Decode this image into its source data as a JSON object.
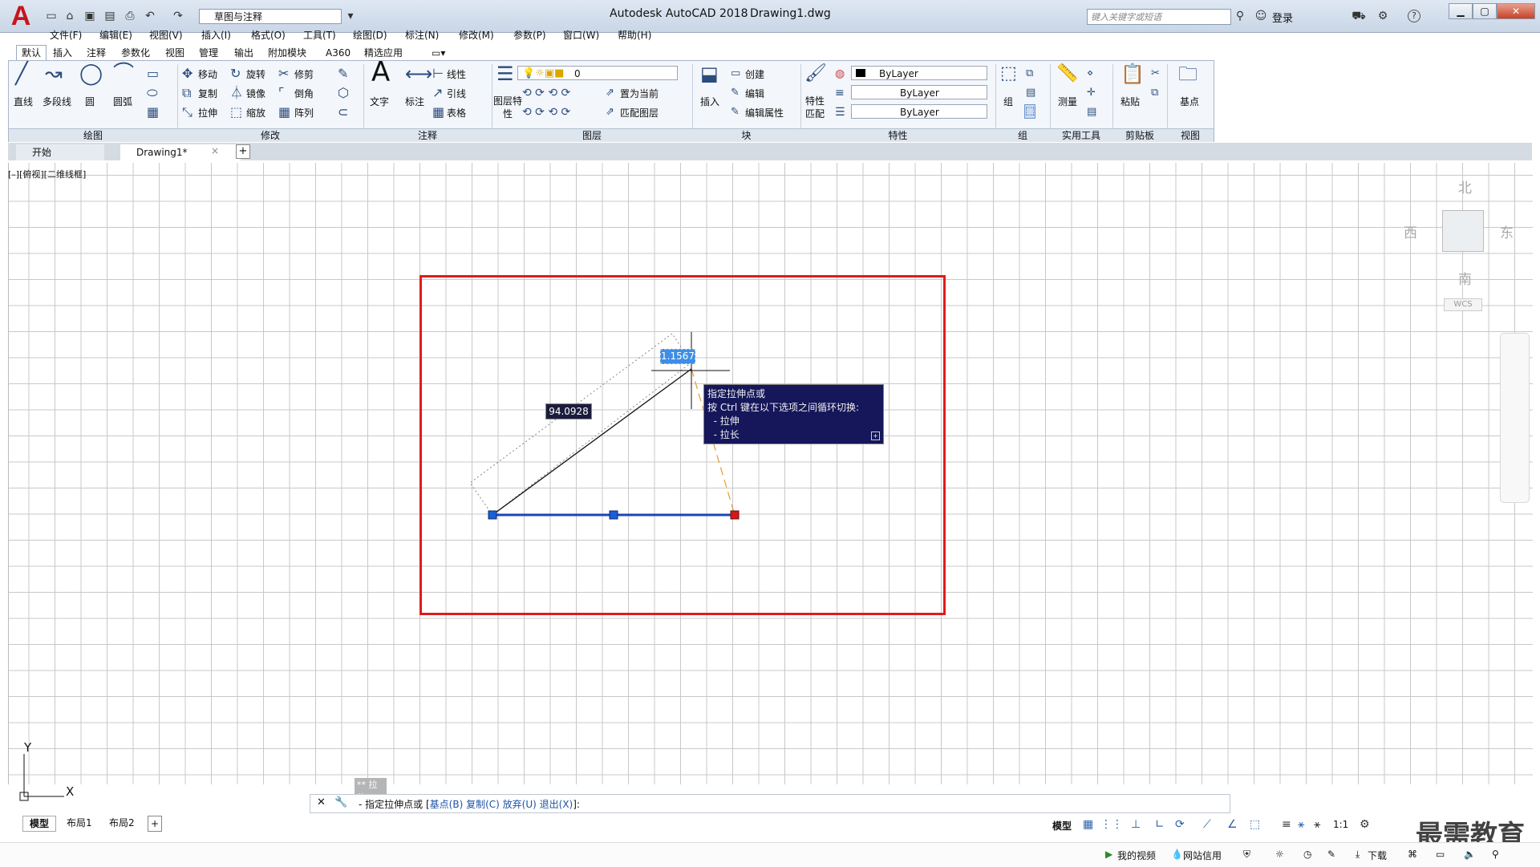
{
  "title_bar": {
    "app_letter": "A",
    "workspace": "草图与注释",
    "app_name": "Autodesk AutoCAD 2018",
    "filename": "Drawing1.dwg",
    "search_placeholder": "键入关键字或短语",
    "login": "登录",
    "help": "?"
  },
  "menu": [
    "文件(F)",
    "编辑(E)",
    "视图(V)",
    "插入(I)",
    "格式(O)",
    "工具(T)",
    "绘图(D)",
    "标注(N)",
    "修改(M)",
    "参数(P)",
    "窗口(W)",
    "帮助(H)"
  ],
  "ribbon_tabs": [
    "默认",
    "插入",
    "注释",
    "参数化",
    "视图",
    "管理",
    "输出",
    "附加模块",
    "A360",
    "精选应用"
  ],
  "ribbon": {
    "draw": {
      "line": "直线",
      "polyline": "多段线",
      "circle": "圆",
      "arc": "圆弧",
      "footer": "绘图"
    },
    "modify": {
      "move": "移动",
      "rotate": "旋转",
      "trim": "修剪",
      "copy": "复制",
      "mirror": "镜像",
      "fillet": "倒角",
      "stretch": "拉伸",
      "scale": "缩放",
      "array": "阵列",
      "footer": "修改"
    },
    "annotation": {
      "text": "文字",
      "dimension": "标注",
      "linear": "线性",
      "leader": "引线",
      "table": "表格",
      "footer": "注释"
    },
    "layers": {
      "properties": "图层特性",
      "current_layer": "0",
      "set_current": "置为当前",
      "match_layer": "匹配图层",
      "footer": "图层"
    },
    "block": {
      "insert": "插入",
      "create": "创建",
      "edit": "编辑",
      "edit_attributes": "编辑属性",
      "footer": "块"
    },
    "properties": {
      "match": "特性匹配",
      "color": "ByLayer",
      "linetype": "ByLayer",
      "lineweight": "ByLayer",
      "footer": "特性"
    },
    "groups": {
      "group": "组",
      "footer": "组"
    },
    "utilities": {
      "measure": "测量",
      "footer": "实用工具"
    },
    "clipboard": {
      "paste": "粘贴",
      "footer": "剪贴板"
    },
    "view": {
      "base": "基点",
      "footer": "视图"
    }
  },
  "doc_tabs": {
    "start": "开始",
    "drawing": "Drawing1*",
    "close": "×",
    "add": "+"
  },
  "viewport": {
    "label": "[–][俯视][二维线框]",
    "north": "北",
    "south": "南",
    "east": "东",
    "west": "西",
    "wcs": "WCS"
  },
  "dimension_input": {
    "length": "94.0928",
    "angle": "1.1567"
  },
  "tooltip": {
    "lines": [
      "指定拉伸点或",
      "按 Ctrl 键在以下选项之间循环切换:",
      "  - 拉伸",
      "  - 拉长"
    ]
  },
  "command": {
    "history": [
      "** 拉伸 **"
    ],
    "prompt": "- 指定拉伸点或 [",
    "options": [
      "基点(B)",
      "复制(C)",
      "放弃(U)",
      "退出(X)"
    ],
    "suffix": "]:"
  },
  "ucs": {
    "x": "X",
    "y": "Y"
  },
  "layout_tabs": [
    "模型",
    "布局1",
    "布局2"
  ],
  "status": {
    "model": "模型",
    "scale": "1:1"
  },
  "taskbar": {
    "video": "我的视频",
    "net": "网站信用",
    "download": "下载"
  },
  "watermark": "最需教育",
  "colors": {
    "frame": "#e01b1b",
    "tooltip_bg": "#15175a",
    "grip_blue": "#1a5fd6",
    "grip_red": "#d41818",
    "selected_line": "#1946b8"
  }
}
